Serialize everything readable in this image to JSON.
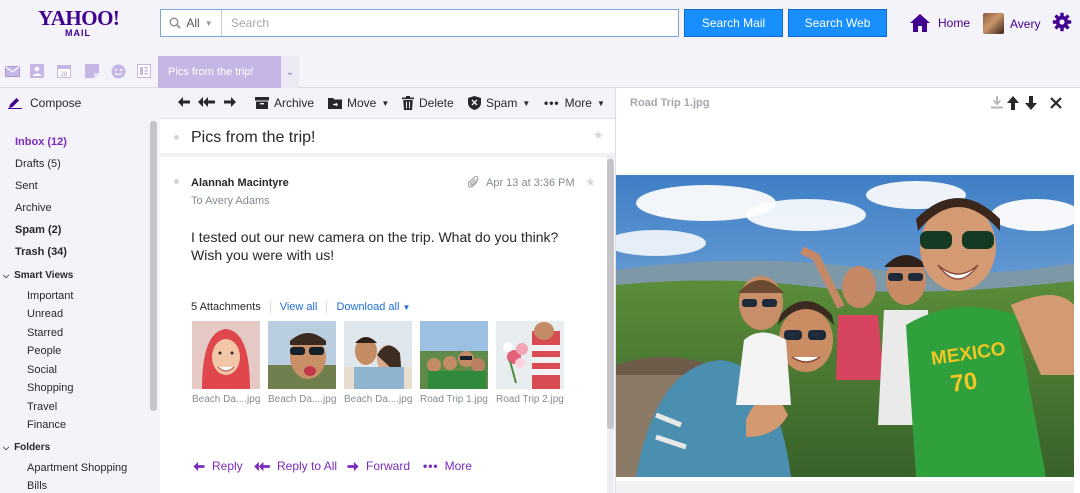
{
  "header": {
    "logo": {
      "line1": "YAHOO!",
      "line2": "MAIL"
    },
    "search": {
      "scope": "All",
      "placeholder": "Search"
    },
    "buttons": {
      "search_mail": "Search Mail",
      "search_web": "Search Web"
    },
    "home_label": "Home",
    "user_name": "Avery"
  },
  "tabs": {
    "active_tab": "Pics from the trip!"
  },
  "sidebar": {
    "compose": "Compose",
    "folders_primary": [
      {
        "label": "Inbox (12)"
      },
      {
        "label": "Drafts (5)"
      },
      {
        "label": "Sent"
      },
      {
        "label": "Archive"
      },
      {
        "label": "Spam (2)"
      },
      {
        "label": "Trash (34)"
      }
    ],
    "smart_views_heading": "Smart Views",
    "smart_views": [
      "Important",
      "Unread",
      "Starred",
      "People",
      "Social",
      "Shopping",
      "Travel",
      "Finance"
    ],
    "folders_heading": "Folders",
    "folders": [
      "Apartment Shopping",
      "Bills"
    ]
  },
  "toolbar": {
    "archive": "Archive",
    "move": "Move",
    "delete": "Delete",
    "spam": "Spam",
    "more": "More"
  },
  "message": {
    "subject": "Pics from the trip!",
    "sender": "Alannah Macintyre",
    "to": "To  Avery Adams",
    "date": "Apr 13 at 3:36 PM",
    "body": "I tested out our new camera on the trip. What do you think? Wish you were with us!",
    "attachments_label": "5 Attachments",
    "view_all": "View all",
    "download_all": "Download all",
    "attachments": [
      {
        "name": "Beach Da....jpg"
      },
      {
        "name": "Beach Da....jpg"
      },
      {
        "name": "Beach Da....jpg"
      },
      {
        "name": "Road Trip 1.jpg"
      },
      {
        "name": "Road Trip 2.jpg"
      }
    ],
    "actions": {
      "reply": "Reply",
      "reply_all": "Reply to All",
      "forward": "Forward",
      "more": "More"
    }
  },
  "preview": {
    "title": "Road Trip 1.jpg"
  },
  "colors": {
    "brand": "#400090",
    "accent": "#188fff",
    "link_purple": "#7b2bbd"
  }
}
